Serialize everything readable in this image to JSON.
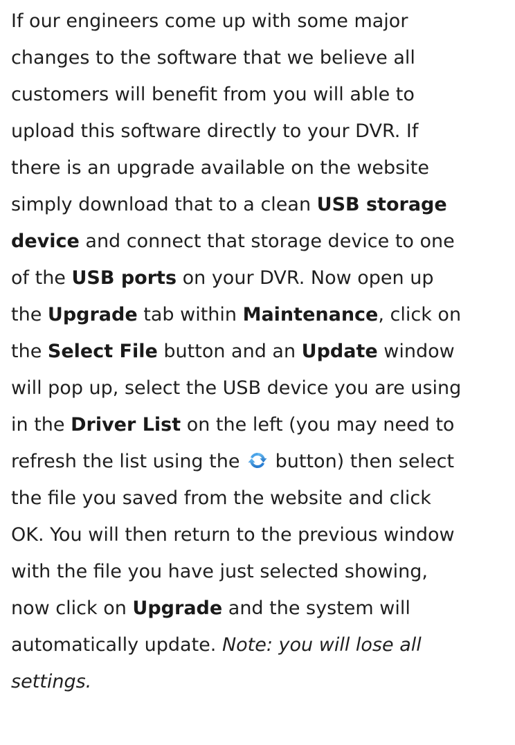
{
  "lines": [
    {
      "t1": "If our engineers come up with some major"
    },
    {
      "t1": "changes to the software that we believe all"
    },
    {
      "t1": "customers will benefit from you will able to"
    },
    {
      "t1": "upload this software directly to your DVR. If"
    },
    {
      "t1": "there is an upgrade available on the website"
    },
    {
      "t1": "simply download that to a clean ",
      "b1": "USB storage"
    },
    {
      "b1": "device",
      "t1": " and connect that storage device to one"
    },
    {
      "t1": "of the ",
      "b1": "USB ports",
      "t2": " on your DVR. Now open up"
    },
    {
      "t1": "the ",
      "b1": "Upgrade",
      "t2": " tab within ",
      "b2": "Maintenance",
      "t3": ", click on"
    },
    {
      "t1": "the ",
      "b1": "Select File",
      "t2": " button and an ",
      "b2": "Update",
      "t3": " window"
    },
    {
      "t1": "will pop up, select the USB device you are using"
    },
    {
      "t1": "in the ",
      "b1": "Driver List",
      "t2": " on the left (you may need to"
    },
    {
      "t1": "refresh the list using the ",
      "t2": " button) then select"
    },
    {
      "t1": "the file you saved from the website and click"
    },
    {
      "t1": "OK. You will then return to the previous window"
    },
    {
      "t1": "with the file you have just selected showing,"
    },
    {
      "t1": "now click on ",
      "b1": "Upgrade",
      "t2": " and the system will"
    },
    {
      "t1": "automatically update. ",
      "i1": "Note: you will lose all"
    },
    {
      "i1": "settings."
    }
  ],
  "icons": {
    "refresh": "refresh-icon"
  },
  "colors": {
    "text": "#1f1f1f",
    "refresh_icon_blue": "#2a7fd4",
    "refresh_icon_light": "#5fb3f0"
  }
}
